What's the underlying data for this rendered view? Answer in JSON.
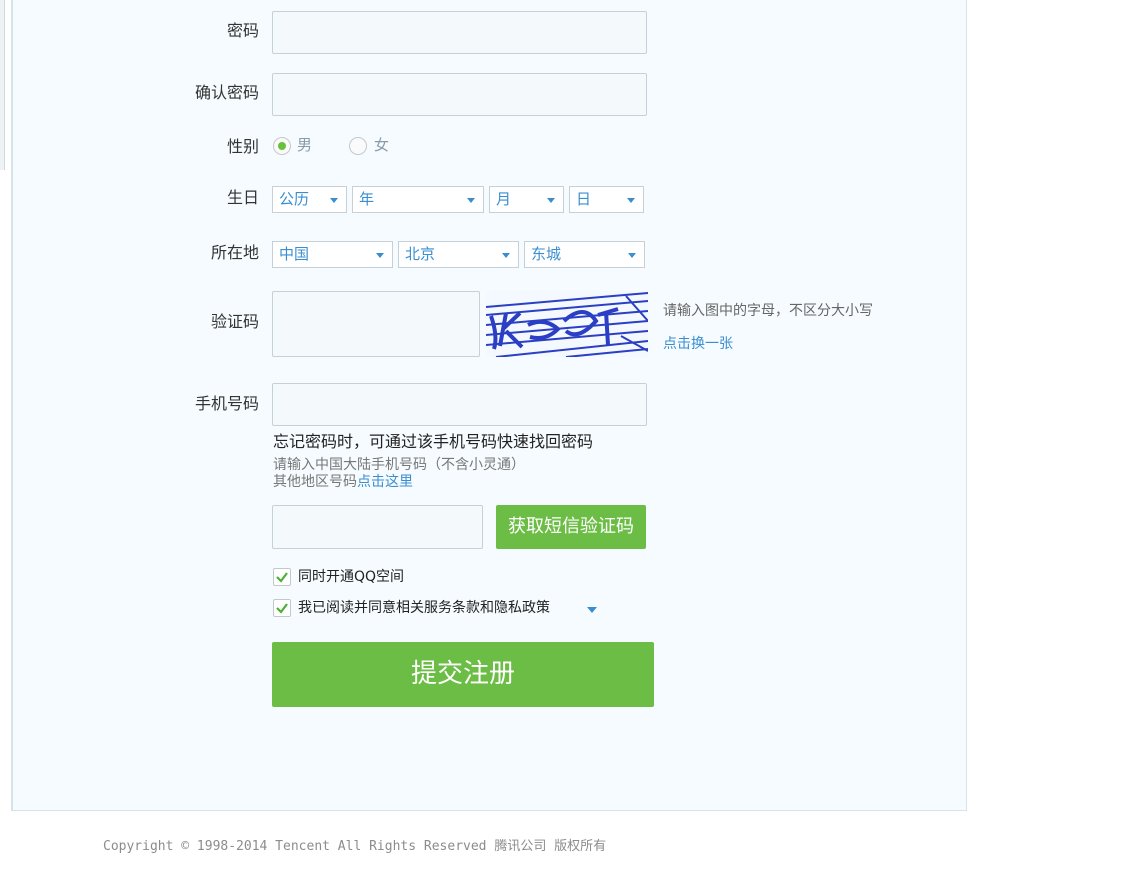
{
  "form": {
    "password": {
      "label": "密码",
      "value": ""
    },
    "confirm_password": {
      "label": "确认密码",
      "value": ""
    },
    "gender": {
      "label": "性别",
      "options": [
        "男",
        "女"
      ],
      "selected": "男"
    },
    "birthday": {
      "label": "生日",
      "calendar": "公历",
      "year": "年",
      "month": "月",
      "day": "日"
    },
    "location": {
      "label": "所在地",
      "country": "中国",
      "province": "北京",
      "city": "东城"
    },
    "captcha": {
      "label": "验证码",
      "value": "",
      "hint": "请输入图中的字母，不区分大小写",
      "refresh_link": "点击换一张"
    },
    "phone": {
      "label": "手机号码",
      "value": "",
      "note": "忘记密码时，可通过该手机号码快速找回密码",
      "hint": "请输入中国大陆手机号码（不含小灵通）",
      "other_region_prefix": "其他地区号码",
      "other_region_link": "点击这里"
    },
    "sms": {
      "value": "",
      "button_label": "获取短信验证码"
    },
    "qzone": {
      "label": "同时开通QQ空间",
      "checked": true
    },
    "agreement": {
      "label": "我已阅读并同意相关服务条款和隐私政策",
      "checked": true
    },
    "submit_label": "提交注册"
  },
  "footer": {
    "text": "Copyright © 1998-2014 Tencent All Rights Reserved 腾讯公司 版权所有"
  },
  "colors": {
    "accent_green": "#6cbd45",
    "link_blue": "#3a8ed0",
    "panel_bg": "#f5fbfe"
  }
}
